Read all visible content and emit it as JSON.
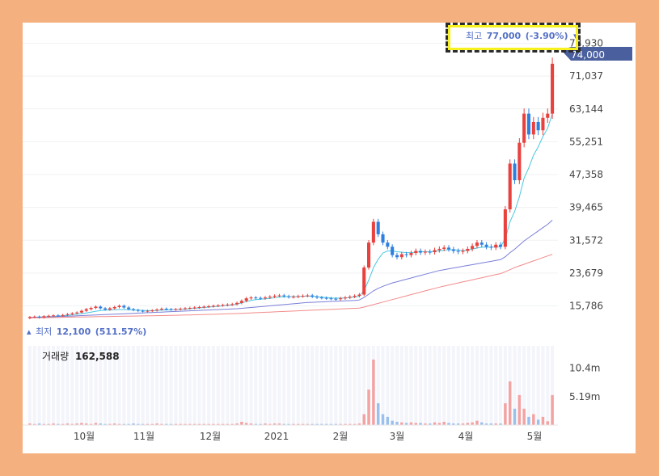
{
  "chart_data": {
    "type": "candlestick",
    "x_ticks": [
      "10월",
      "11월",
      "12월",
      "2021",
      "2월",
      "3월",
      "4월",
      "5월"
    ],
    "y_ticks": [
      "78,930",
      "71,037",
      "63,144",
      "55,251",
      "47,358",
      "39,465",
      "31,572",
      "23,679",
      "15,786"
    ],
    "y_tick_values": [
      78930,
      71037,
      63144,
      55251,
      47358,
      39465,
      31572,
      23679,
      15786
    ],
    "ylim": [
      12000,
      80000
    ],
    "current_price_label": "74,000",
    "current_price": 74000,
    "high_label": "최고",
    "high_value": "77,000",
    "high_change": "(-3.90%)",
    "low_label": "최저",
    "low_value": "12,100",
    "low_change": "(511.57%)",
    "volume_label": "거래량",
    "volume_value": "162,588",
    "volume_ticks": [
      "10.4m",
      "5.19m"
    ],
    "volume_tick_values": [
      10.4,
      5.19
    ],
    "volume_max": 14.5,
    "price_series_close": [
      13100,
      13200,
      13000,
      13300,
      13400,
      13500,
      13400,
      13600,
      13800,
      14000,
      14200,
      14600,
      15000,
      15300,
      15600,
      15200,
      14900,
      15200,
      15500,
      15800,
      15400,
      15000,
      14800,
      14600,
      14500,
      14600,
      14700,
      14900,
      15100,
      15000,
      14900,
      15000,
      15100,
      15200,
      15300,
      15400,
      15500,
      15600,
      15700,
      15800,
      15900,
      16000,
      16100,
      16200,
      16500,
      17000,
      17600,
      17800,
      17700,
      17600,
      17800,
      18000,
      18200,
      18300,
      18100,
      17900,
      18000,
      18100,
      18200,
      18300,
      18000,
      17800,
      17700,
      17600,
      17500,
      17400,
      17600,
      17800,
      18000,
      18200,
      18500,
      25000,
      31000,
      36000,
      33000,
      31000,
      30000,
      28000,
      27500,
      28200,
      28000,
      28500,
      29000,
      28600,
      28800,
      28700,
      29200,
      29500,
      29800,
      29400,
      29000,
      28800,
      29000,
      29500,
      30200,
      31000,
      30500,
      30000,
      29800,
      30500,
      30000,
      39000,
      50000,
      46000,
      55000,
      62000,
      57000,
      60000,
      58000,
      61000,
      62000,
      74000
    ],
    "series": [
      {
        "name": "",
        "color": "#47c8e0",
        "values": [
          13000,
          13050,
          13100,
          13150,
          13200,
          13250,
          13300,
          13400,
          13500,
          13650,
          13800,
          13950,
          14100,
          14300,
          14500,
          14650,
          14750,
          14800,
          14850,
          14900,
          14900,
          14850,
          14800,
          14750,
          14700,
          14650,
          14650,
          14700,
          14750,
          14800,
          14850,
          14900,
          14950,
          15000,
          15100,
          15200,
          15300,
          15400,
          15500,
          15600,
          15700,
          15800,
          15900,
          16000,
          16200,
          16500,
          16800,
          17100,
          17300,
          17400,
          17500,
          17600,
          17750,
          17900,
          18000,
          18000,
          18000,
          18050,
          18100,
          18150,
          18100,
          18000,
          17900,
          17800,
          17700,
          17650,
          17650,
          17700,
          17800,
          17900,
          18100,
          19500,
          22000,
          25000,
          27000,
          28500,
          29000,
          29000,
          28800,
          28700,
          28600,
          28600,
          28700,
          28800,
          28800,
          28800,
          28900,
          29000,
          29200,
          29300,
          29300,
          29200,
          29100,
          29200,
          29400,
          29700,
          29900,
          29900,
          29900,
          30000,
          30000,
          32000,
          36000,
          38500,
          42000,
          46500,
          49000,
          52000,
          54000,
          56500,
          58500,
          62000
        ]
      },
      {
        "name": "",
        "color": "#7a7fd8",
        "values": [
          13000,
          13000,
          13050,
          13100,
          13100,
          13150,
          13200,
          13250,
          13300,
          13350,
          13400,
          13450,
          13500,
          13550,
          13600,
          13650,
          13700,
          13750,
          13800,
          13850,
          13900,
          13950,
          14000,
          14050,
          14100,
          14150,
          14200,
          14250,
          14300,
          14350,
          14400,
          14450,
          14500,
          14550,
          14600,
          14650,
          14700,
          14750,
          14800,
          14850,
          14900,
          14950,
          15000,
          15050,
          15100,
          15200,
          15300,
          15400,
          15500,
          15600,
          15700,
          15800,
          15900,
          16000,
          16100,
          16200,
          16300,
          16400,
          16500,
          16600,
          16650,
          16700,
          16750,
          16800,
          16850,
          16900,
          16950,
          17000,
          17050,
          17100,
          17200,
          17800,
          18600,
          19400,
          20000,
          20500,
          20900,
          21300,
          21600,
          21900,
          22200,
          22500,
          22800,
          23100,
          23400,
          23700,
          24000,
          24300,
          24500,
          24700,
          24900,
          25100,
          25300,
          25500,
          25700,
          25900,
          26100,
          26300,
          26500,
          26700,
          26900,
          27600,
          28600,
          29400,
          30400,
          31400,
          32200,
          33000,
          33800,
          34600,
          35400,
          36400
        ]
      },
      {
        "name": "",
        "color": "#f28b8b",
        "values": [
          12900,
          12920,
          12940,
          12960,
          12980,
          13000,
          13020,
          13040,
          13060,
          13080,
          13100,
          13120,
          13140,
          13160,
          13180,
          13200,
          13220,
          13240,
          13260,
          13280,
          13300,
          13320,
          13340,
          13360,
          13380,
          13400,
          13420,
          13440,
          13460,
          13480,
          13500,
          13530,
          13560,
          13590,
          13620,
          13650,
          13680,
          13710,
          13740,
          13770,
          13800,
          13840,
          13880,
          13920,
          13960,
          14000,
          14050,
          14100,
          14150,
          14200,
          14250,
          14300,
          14350,
          14400,
          14450,
          14500,
          14550,
          14600,
          14650,
          14700,
          14750,
          14800,
          14850,
          14900,
          14950,
          15000,
          15050,
          15100,
          15150,
          15200,
          15250,
          15500,
          15800,
          16100,
          16400,
          16700,
          17000,
          17300,
          17600,
          17900,
          18200,
          18500,
          18800,
          19100,
          19400,
          19700,
          20000,
          20300,
          20550,
          20800,
          21050,
          21300,
          21550,
          21800,
          22050,
          22300,
          22550,
          22800,
          23050,
          23300,
          23550,
          24000,
          24500,
          25000,
          25400,
          25800,
          26200,
          26600,
          27000,
          27400,
          27800,
          28200
        ]
      }
    ],
    "volume_values": [
      0.3,
      0.2,
      0.3,
      0.2,
      0.2,
      0.3,
      0.2,
      0.2,
      0.3,
      0.2,
      0.3,
      0.4,
      0.3,
      0.2,
      0.4,
      0.3,
      0.2,
      0.2,
      0.3,
      0.2,
      0.2,
      0.2,
      0.3,
      0.2,
      0.2,
      0.2,
      0.2,
      0.3,
      0.2,
      0.2,
      0.2,
      0.2,
      0.2,
      0.2,
      0.2,
      0.2,
      0.2,
      0.2,
      0.2,
      0.2,
      0.2,
      0.2,
      0.2,
      0.2,
      0.3,
      0.6,
      0.4,
      0.3,
      0.2,
      0.2,
      0.3,
      0.2,
      0.3,
      0.3,
      0.2,
      0.2,
      0.2,
      0.2,
      0.2,
      0.2,
      0.2,
      0.2,
      0.2,
      0.2,
      0.2,
      0.2,
      0.2,
      0.2,
      0.2,
      0.2,
      0.3,
      2.0,
      6.5,
      12.0,
      4.0,
      2.0,
      1.5,
      0.8,
      0.6,
      0.5,
      0.4,
      0.5,
      0.4,
      0.4,
      0.3,
      0.3,
      0.5,
      0.4,
      0.6,
      0.4,
      0.3,
      0.3,
      0.3,
      0.4,
      0.5,
      0.8,
      0.5,
      0.3,
      0.3,
      0.3,
      0.3,
      4.0,
      8.0,
      3.0,
      5.5,
      3.0,
      1.5,
      2.0,
      1.0,
      1.5,
      0.7,
      5.5
    ]
  },
  "colors": {
    "up": "#e8413e",
    "down": "#2f7fe0",
    "badge": "#4a5f9e",
    "label_blue": "#5470c6"
  }
}
